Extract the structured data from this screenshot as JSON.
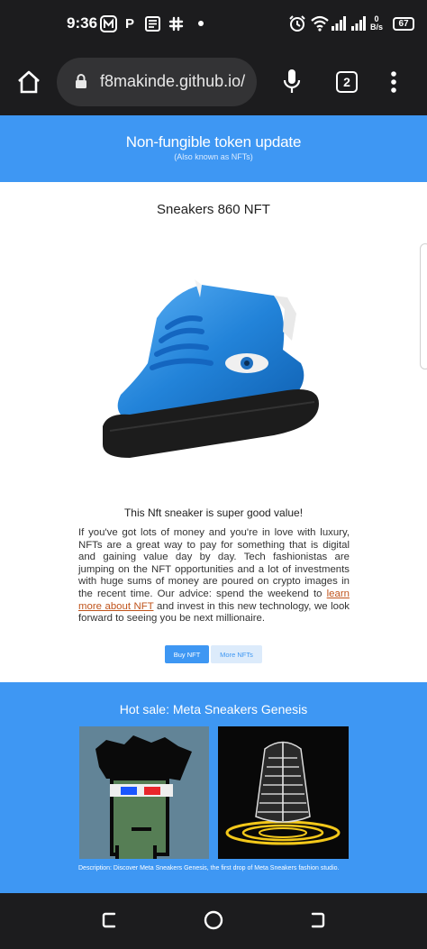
{
  "status": {
    "time": "9:36",
    "app_icon_p": "P",
    "battery": "67",
    "netspeed_value": "0",
    "netspeed_unit": "B/s"
  },
  "browser": {
    "url": "f8makinde.github.io/",
    "tab_count": "2"
  },
  "hero": {
    "title": "Non-fungible token update",
    "subtitle": "(Also known as NFTs)"
  },
  "card": {
    "title": "Sneakers 860 NFT",
    "subtitle": "This Nft sneaker is super good value!",
    "paragraph_start": "If you've got lots of money and you're in love with luxury, NFTs are a great way to pay for something that is digital and gaining value day by day. Tech fashionistas are jumping on the NFT opportunities and a lot of investments with huge sums of money are poured on crypto images in the recent time. Our advice: spend the weekend to ",
    "paragraph_link": "learn more about NFT",
    "paragraph_end": " and invest in this new technology, we look forward to seeing you be next millionaire.",
    "buy_button": "Buy NFT",
    "more_button": "More NFTs"
  },
  "sale": {
    "title": "Hot sale: Meta Sneakers Genesis",
    "description": "Description: Discover Meta Sneakers Genesis, the first drop of Meta Sneakers fashion studio."
  },
  "colors": {
    "accent": "#3e97f3",
    "link": "#c0541c"
  },
  "icons": [
    "home-icon",
    "lock-icon",
    "microphone-icon",
    "more-vert-icon",
    "recents-icon",
    "home-circle-icon",
    "back-icon"
  ]
}
